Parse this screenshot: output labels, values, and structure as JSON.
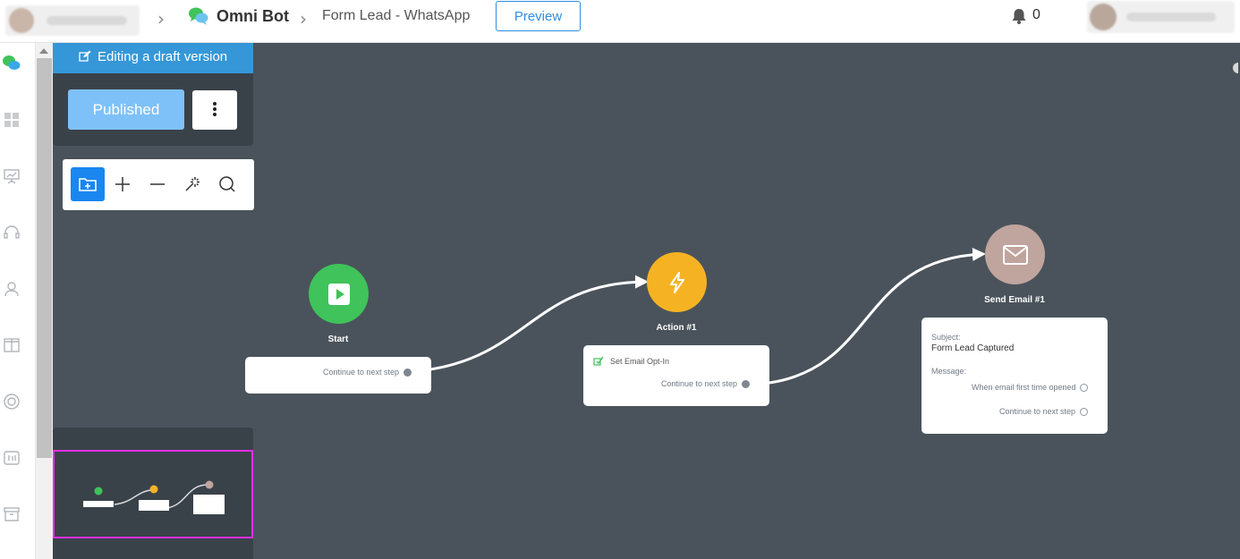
{
  "header": {
    "brand_name": "Omni Bot",
    "flow_name": "Form Lead - WhatsApp",
    "preview_label": "Preview",
    "notification_count": "0"
  },
  "editor": {
    "draft_banner": "Editing a draft version",
    "published_label": "Published"
  },
  "nodes": {
    "start": {
      "title": "Start",
      "continue_label": "Continue to next step",
      "color": "#3fc35a"
    },
    "action": {
      "title": "Action #1",
      "step_label": "Set Email Opt-In",
      "continue_label": "Continue to next step",
      "color": "#f5b324"
    },
    "email": {
      "title": "Send Email #1",
      "subject_label": "Subject:",
      "subject_value": "Form Lead Captured",
      "message_label": "Message:",
      "opened_label": "When email first time opened",
      "continue_label": "Continue to next step",
      "color": "#c0a49e"
    }
  },
  "colors": {
    "canvas": "#4a535b",
    "accent": "#3597d8",
    "active_tool": "#1a86f0",
    "minimap_highlight": "#e12ee6"
  }
}
